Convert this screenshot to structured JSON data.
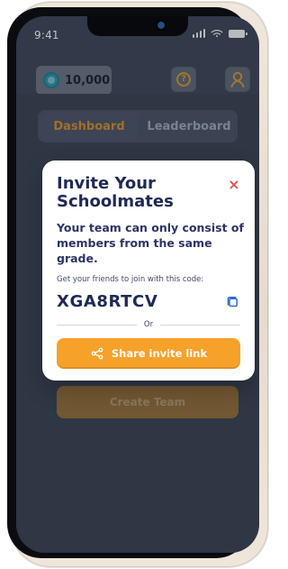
{
  "status_bar": {
    "time": "9:41"
  },
  "header": {
    "coins": "10,000"
  },
  "tabs": [
    {
      "label": "Dashboard",
      "active": true
    },
    {
      "label": "Leaderboard",
      "active": false
    }
  ],
  "background": {
    "cta_label": "Create Team"
  },
  "modal": {
    "title": "Invite Your Schoolmates",
    "subtitle": "Your team can only consist of members from the same grade.",
    "code_hint": "Get your friends to join with this code:",
    "code": "XGA8RTCV",
    "divider_label": "Or",
    "share_label": "Share invite link",
    "close_label": "×"
  },
  "icons": {
    "coin": "coin-icon",
    "help": "help-icon",
    "profile": "profile-icon",
    "close": "close-icon",
    "copy": "copy-icon",
    "share": "share-icon"
  },
  "colors": {
    "accent_orange": "#f6a12a",
    "title_navy": "#1f2a55",
    "close_red": "#e15252",
    "copy_blue": "#2a6cc7",
    "dim_blue": "#3e4658"
  }
}
